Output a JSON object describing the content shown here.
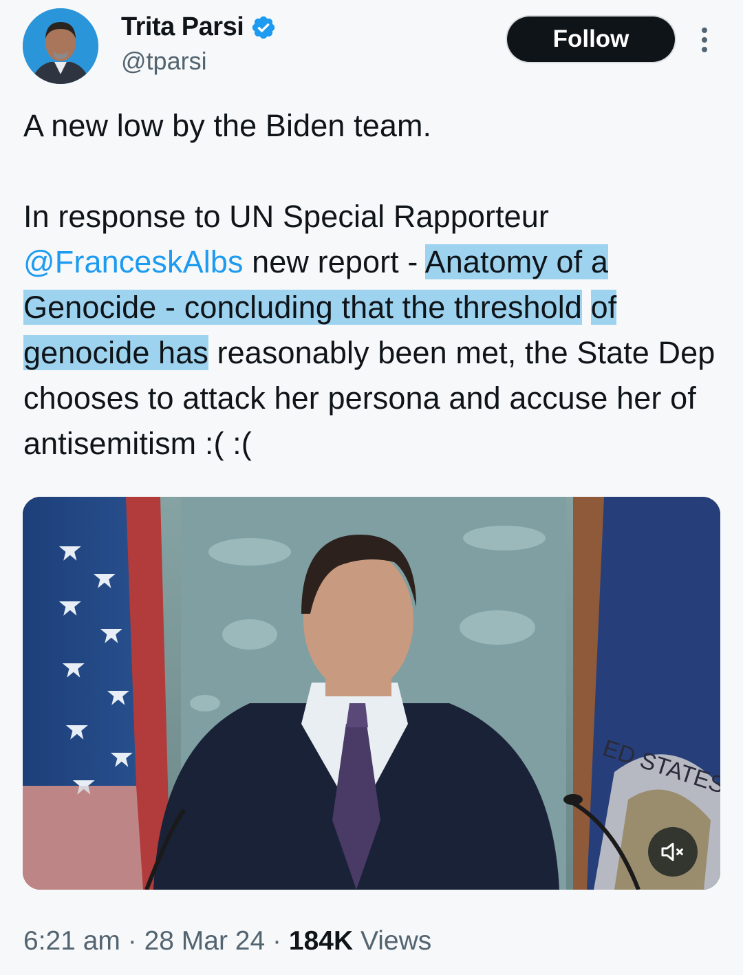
{
  "author": {
    "display_name": "Trita Parsi",
    "handle": "@tparsi",
    "verified": true
  },
  "follow_label": "Follow",
  "tweet": {
    "line1": "A new low by the Biden team.",
    "p2_prefix": "In response to UN Special Rapporteur ",
    "mention": "@FranceskAlbs",
    "p2_mid": " new report - ",
    "highlight_1": "Anatomy of a",
    "highlight_2": "Genocide - concluding that the threshold",
    "highlight_3": "of genocide has",
    "p2_suffix": " reasonably been met, the State Dep chooses to attack her persona and accuse her of antisemitism :( :("
  },
  "media": {
    "type": "video",
    "seal_text": "ED STATES",
    "muted": true
  },
  "meta": {
    "time": "6:21 am",
    "sep1": " · ",
    "date": "28 Mar 24",
    "sep2": " · ",
    "views_count": "184K",
    "views_label": " Views"
  },
  "colors": {
    "link": "#1d9bf0",
    "highlight": "#9ed3f0",
    "verified": "#1d9bf0"
  }
}
